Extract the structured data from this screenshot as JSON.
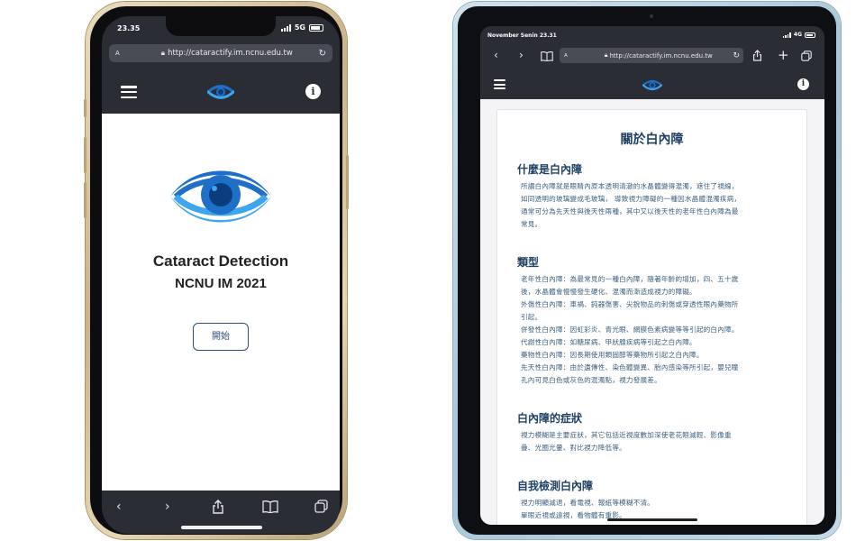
{
  "phone": {
    "status": {
      "time": "23.35",
      "network": "5G"
    },
    "url": "http://cataractify.im.ncnu.edu.tw",
    "url_prefix": "A",
    "title": "Cataract Detection",
    "subtitle": "NCNU IM 2021",
    "start_button": "開始",
    "info_glyph": "i",
    "bottom_icons": [
      "chevron-left-icon",
      "chevron-right-icon",
      "share-icon",
      "bookmarks-icon",
      "tabs-icon"
    ],
    "eye_colors": {
      "dark": "#0b3d7c",
      "mid": "#1e6fc7",
      "light": "#3ea6ef"
    }
  },
  "tablet": {
    "status": {
      "time": "November Senin 23.31",
      "network": "4G"
    },
    "url": "http://cataractify.im.ncnu.edu.tw",
    "url_prefix": "A",
    "info_glyph": "i",
    "page_title": "關於白內障",
    "sections": [
      {
        "heading": "什麼是白內障",
        "lines": [
          "所謂白內障就是眼睛內原本透明清澈的水晶體變得混濁，遮住了視線，",
          "如同透明的玻璃變成毛玻璃， 導致視力障礙的一種因水晶體混濁疾病，",
          "通常可分為先天性與後天性兩種，其中又以後天性的老年性白內障為最",
          "常見。"
        ]
      },
      {
        "heading": "類型",
        "lines": [
          "老年性白內障：為最常見的一種白內障，隨著年齡的增加，四、五十歲",
          "後，水晶體會慢慢發生硬化、混濁而漸造成視力的障礙。",
          "外傷性白內障：車禍、鈍器傷害、尖銳物品的刺傷或穿透性眼內藥物所",
          "引起。",
          "併發性白內障：因虹彩炎、青光眼、網膜色素病變等等引起的白內障。",
          "代謝性白內障：如糖尿病、甲狀腺疾病等引起之白內障。",
          "藥物性白內障：因長期使用類固醇等藥物所引起之白內障。",
          "先天性白內障：由於遺傳性、染色體變異、胎內感染等所引起，嬰兒瞳",
          "孔內可見白色或灰色的混濁點，視力發展差。"
        ]
      },
      {
        "heading": "白內障的症狀",
        "lines": [
          "視力模糊是主要症狀，其它包括近視度數加深使老花眼減輕、影像重",
          "疊、光圈光暈、對比視力降低等。"
        ]
      },
      {
        "heading": "自我檢測白內障",
        "lines": [
          "視力明顯減退，看電視、報紙等模糊不清。",
          "單眼近視或遠視，看物體有重影。"
        ]
      }
    ]
  }
}
